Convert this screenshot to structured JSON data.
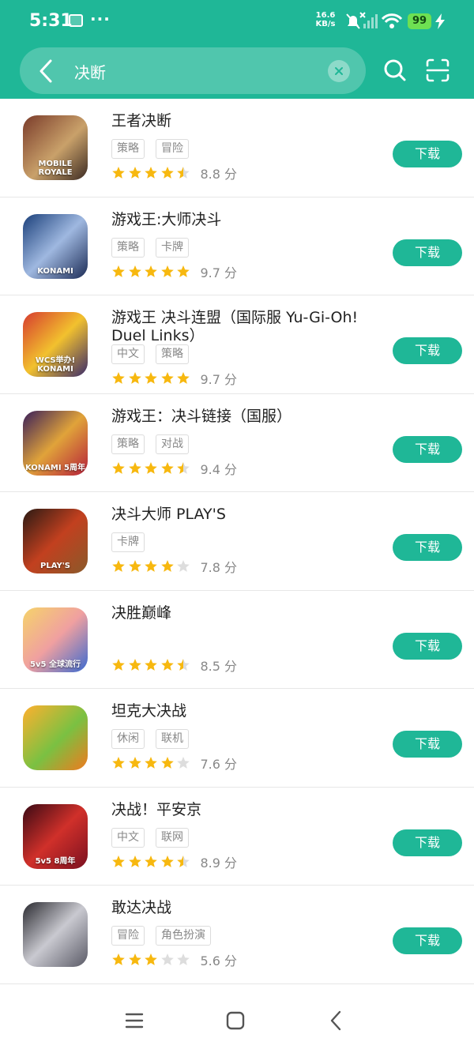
{
  "status": {
    "time": "5:31",
    "dots": "···",
    "speed_value": "16.6",
    "speed_unit": "KB/s",
    "battery": "99"
  },
  "search": {
    "query": "决断"
  },
  "download_label": "下载",
  "score_suffix": "分",
  "colors": {
    "brand": "#1fb797",
    "star": "#f7b80f",
    "star_empty": "#dddddd"
  },
  "apps": [
    {
      "name": "王者决断",
      "tags": [
        "策略",
        "冒险"
      ],
      "rating": 4.5,
      "score": "8.8",
      "icon_text": "MOBILE ROYALE"
    },
    {
      "name": "游戏王:大师决斗",
      "tags": [
        "策略",
        "卡牌"
      ],
      "rating": 5,
      "score": "9.7",
      "icon_text": "KONAMI"
    },
    {
      "name": "游戏王 决斗连盟（国际服 Yu-Gi-Oh! Duel Links）",
      "tags": [
        "中文",
        "策略"
      ],
      "rating": 5,
      "score": "9.7",
      "icon_text": "WCS举办! KONAMI"
    },
    {
      "name": "游戏王：决斗链接（国服）",
      "tags": [
        "策略",
        "对战"
      ],
      "rating": 4.5,
      "score": "9.4",
      "icon_text": "KONAMI 5周年"
    },
    {
      "name": "决斗大师 PLAY'S",
      "tags": [
        "卡牌"
      ],
      "rating": 4,
      "score": "7.8",
      "icon_text": "PLAY'S"
    },
    {
      "name": "决胜巅峰",
      "tags": [],
      "rating": 4.5,
      "score": "8.5",
      "icon_text": "5v5 全球流行"
    },
    {
      "name": "坦克大决战",
      "tags": [
        "休闲",
        "联机"
      ],
      "rating": 4,
      "score": "7.6",
      "icon_text": ""
    },
    {
      "name": "决战！平安京",
      "tags": [
        "中文",
        "联网"
      ],
      "rating": 4.5,
      "score": "8.9",
      "icon_text": "5v5 8周年"
    },
    {
      "name": "敢达决战",
      "tags": [
        "冒险",
        "角色扮演"
      ],
      "rating": 3,
      "score": "5.6",
      "icon_text": ""
    }
  ]
}
